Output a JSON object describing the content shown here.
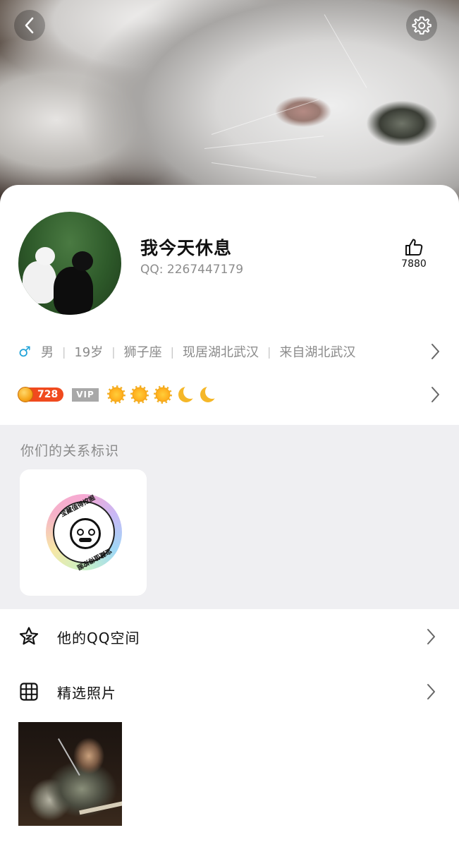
{
  "header": {
    "back_icon": "chevron-left-icon",
    "settings_icon": "gear-icon",
    "cover_subject": "white-cat-cover-photo"
  },
  "profile": {
    "nickname": "我今天休息",
    "qq_label": "QQ: 2267447179",
    "like_icon": "thumbs-up-icon",
    "like_count": "7880",
    "gender_symbol": "♂",
    "gender": "男",
    "age": "19岁",
    "zodiac": "狮子座",
    "residence": "现居湖北武汉",
    "hometown": "来自湖北武汉",
    "separator": "|"
  },
  "badges": {
    "coin_value": "728",
    "vip_label": "VIP",
    "level_icons": [
      "sun",
      "sun",
      "sun",
      "moon",
      "moon"
    ]
  },
  "relation": {
    "title": "你们的关系标识",
    "medal_text": "宝藏值得挖掘",
    "medal_colors": [
      "#f6a9d3",
      "#c9b8f5",
      "#9fd8f7",
      "#c9f2c4",
      "#f7e7a6"
    ]
  },
  "list": {
    "qzone_label": "他的QQ空间",
    "qzone_icon": "star-icon",
    "photos_label": "精选照片",
    "photos_icon": "grid-icon"
  },
  "colors": {
    "accent_male": "#1fa2d8",
    "coin_badge": "#f04a1e",
    "vip_badge": "#a8a8a8",
    "section_bg": "#efeff2",
    "secondary_text": "#8a8a8a"
  }
}
